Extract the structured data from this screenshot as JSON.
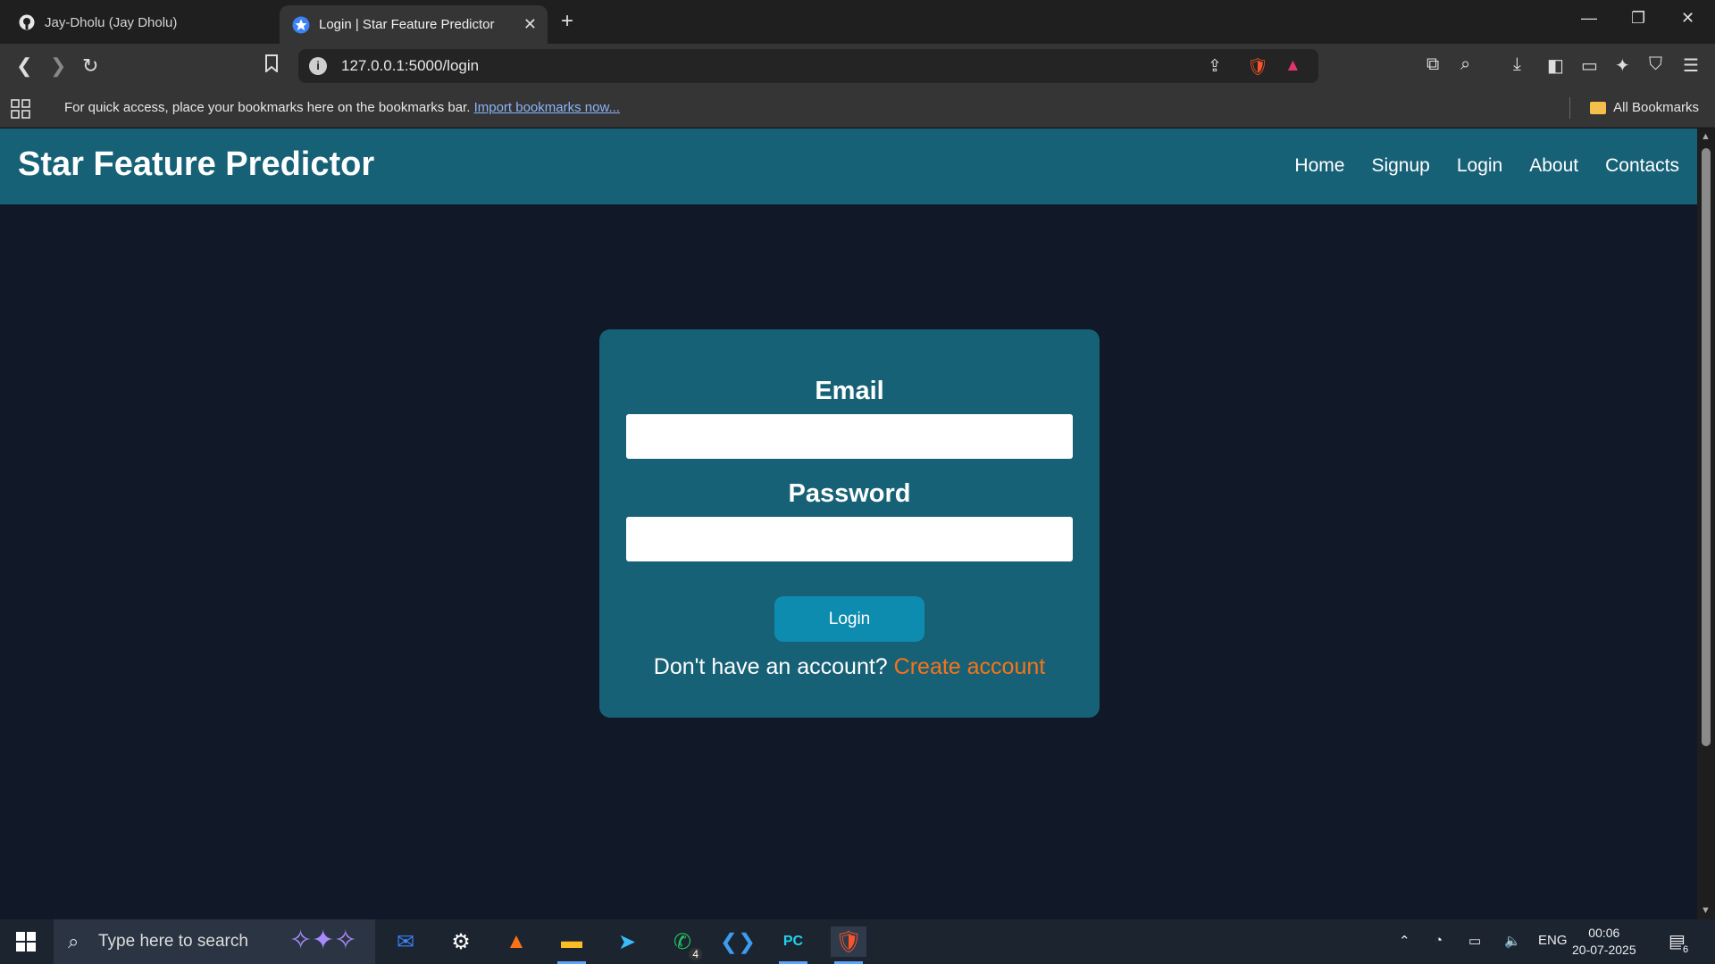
{
  "browser": {
    "tabs": [
      {
        "title": "Jay-Dholu (Jay Dholu)",
        "icon": "github-icon"
      },
      {
        "title": "Login | Star Feature Predictor",
        "icon": "star-icon"
      }
    ],
    "url": "127.0.0.1:5000/login",
    "bookmarks_message": "For quick access, place your bookmarks here on the bookmarks bar.",
    "bookmarks_link": "Import bookmarks now...",
    "all_bookmarks": "All Bookmarks"
  },
  "site": {
    "brand": "Star Feature Predictor",
    "nav": [
      "Home",
      "Signup",
      "Login",
      "About",
      "Contacts"
    ]
  },
  "login_form": {
    "email_label": "Email",
    "password_label": "Password",
    "submit_label": "Login",
    "signup_prompt": "Don't have an account?",
    "signup_link": "Create account"
  },
  "taskbar": {
    "search_placeholder": "Type here to search",
    "whatsapp_badge": "4",
    "language": "ENG",
    "time": "00:06",
    "date": "20-07-2025",
    "notifications_count": "6"
  },
  "colors": {
    "navbar": "#176177",
    "card": "#176177",
    "page_bg": "#111827",
    "button": "#0e8caf",
    "link_accent": "#f97316"
  }
}
